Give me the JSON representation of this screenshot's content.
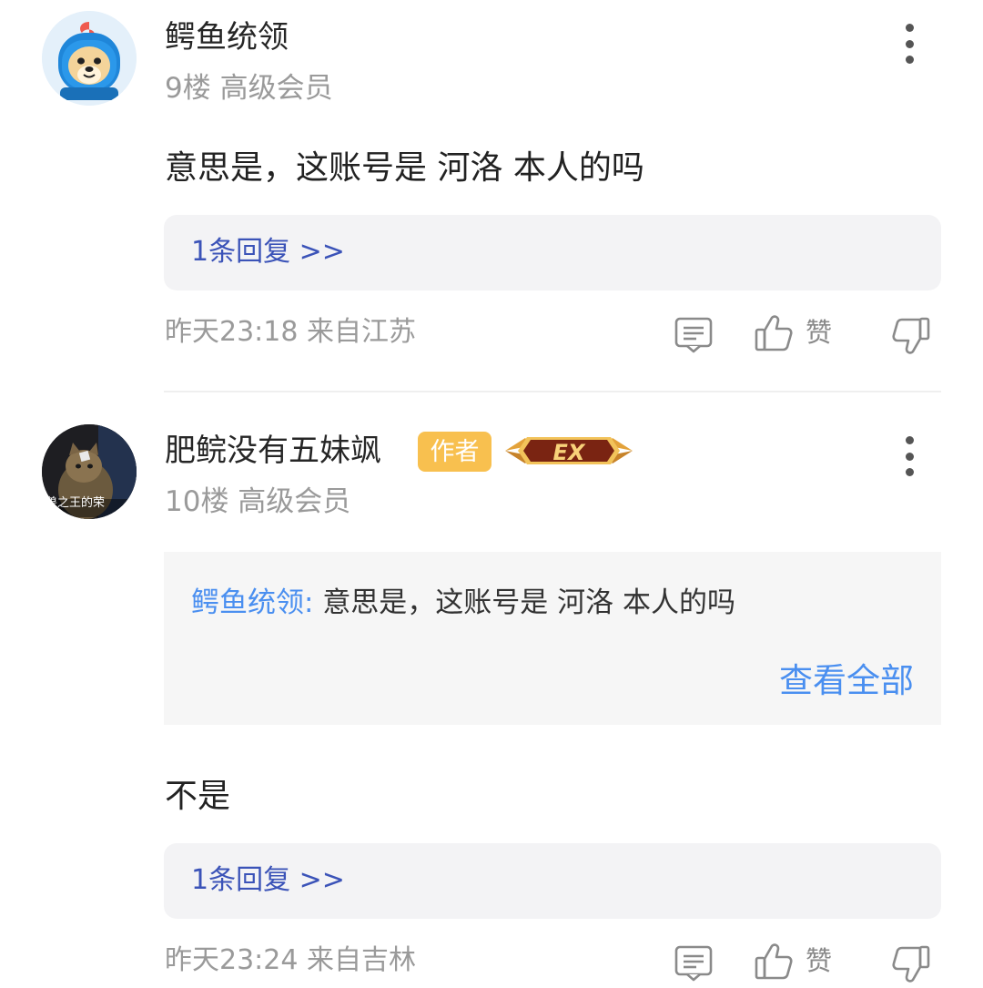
{
  "posts": [
    {
      "username": "鳄鱼统领",
      "meta": "9楼 高级会员",
      "content": "意思是，这账号是 河洛 本人的吗",
      "reply_link": "1条回复 >>",
      "footer": "昨天23:18 来自江苏",
      "like_label": "赞",
      "avatar_icon": "blue-hood-dog-avatar-icon"
    },
    {
      "username": "肥鲩没有五妹飒",
      "author_badge": "作者",
      "level_badge": "EX",
      "meta": "10楼 高级会员",
      "avatar_caption": "兽之王的荣",
      "quote": {
        "author": "鳄鱼统领:",
        "text": "意思是，这账号是 河洛 本人的吗",
        "view_all": "查看全部"
      },
      "content": "不是",
      "reply_link": "1条回复 >>",
      "footer": "昨天23:24 来自吉林",
      "like_label": "赞",
      "avatar_icon": "cat-photo-avatar-icon"
    }
  ],
  "colors": {
    "link_blue": "#3b53b8",
    "quote_blue": "#4a8ff0",
    "author_badge": "#f8c04f",
    "muted_text": "#9a9a9a",
    "reply_bg": "#f3f3f5"
  },
  "icons": [
    "more-vertical-icon",
    "comment-icon",
    "thumb-up-icon",
    "thumb-down-icon",
    "ex-level-badge-icon"
  ]
}
